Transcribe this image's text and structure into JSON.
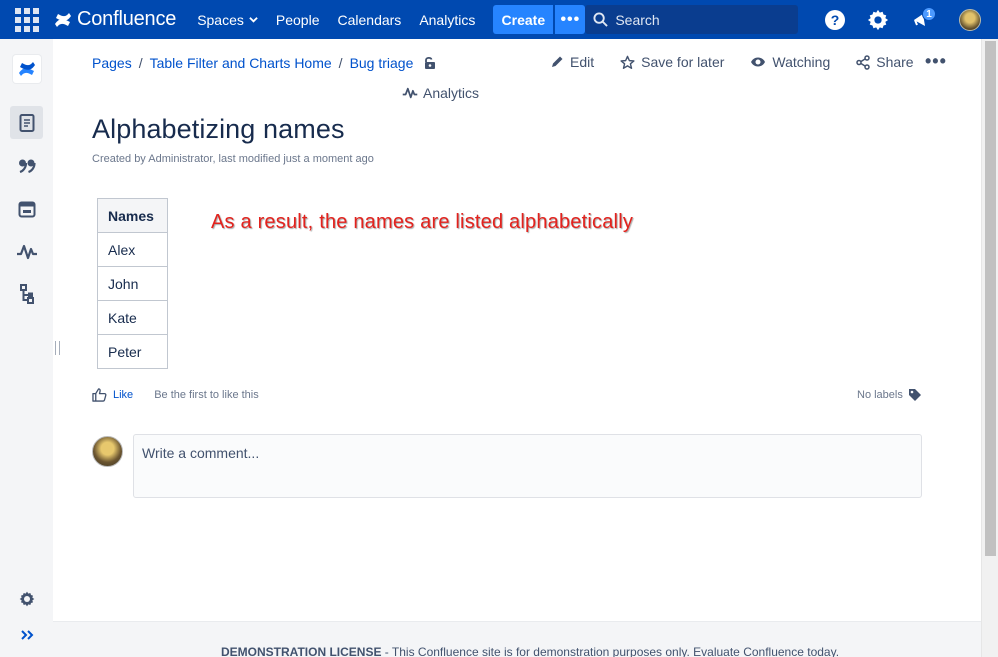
{
  "topnav": {
    "logo_text": "Confluence",
    "links": {
      "spaces": "Spaces",
      "people": "People",
      "calendars": "Calendars",
      "analytics": "Analytics"
    },
    "create_label": "Create",
    "more_label": "•••",
    "search_placeholder": "Search",
    "notification_count": "1"
  },
  "breadcrumbs": {
    "pages": "Pages",
    "separator": "/",
    "space_home": "Table Filter and Charts Home",
    "parent": "Bug triage"
  },
  "page_actions": {
    "edit": "Edit",
    "save_for_later": "Save for later",
    "watching": "Watching",
    "share": "Share",
    "more": "•••",
    "analytics": "Analytics"
  },
  "page": {
    "title": "Alphabetizing names",
    "byline": "Created by Administrator, last modified just a moment ago"
  },
  "table": {
    "header": "Names",
    "rows": [
      "Alex",
      "John",
      "Kate",
      "Peter"
    ]
  },
  "annotation": "As a result, the names are listed alphabetically",
  "likes": {
    "like_label": "Like",
    "first_to_like": "Be the first to like this",
    "labels": "No labels"
  },
  "comment": {
    "placeholder": "Write a comment..."
  },
  "footer": {
    "license_bold": "DEMONSTRATION LICENSE",
    "license_text": " - This Confluence site is for demonstration purposes only. Evaluate Confluence today."
  },
  "colors": {
    "nav_bg": "#0049b0",
    "create_bg": "#2684ff",
    "link": "#0052cc",
    "annotation": "#e3221d"
  },
  "icons": [
    "app-switcher-icon",
    "confluence-logo-icon",
    "search-icon",
    "help-icon",
    "settings-icon",
    "notifications-icon",
    "lock-icon",
    "edit-icon",
    "star-icon",
    "eye-icon",
    "share-icon",
    "analytics-icon",
    "like-icon",
    "tag-icon",
    "pages-icon",
    "quote-icon",
    "calendar-icon",
    "analytics-rail-icon",
    "tree-icon",
    "gear-icon",
    "expand-icon"
  ]
}
